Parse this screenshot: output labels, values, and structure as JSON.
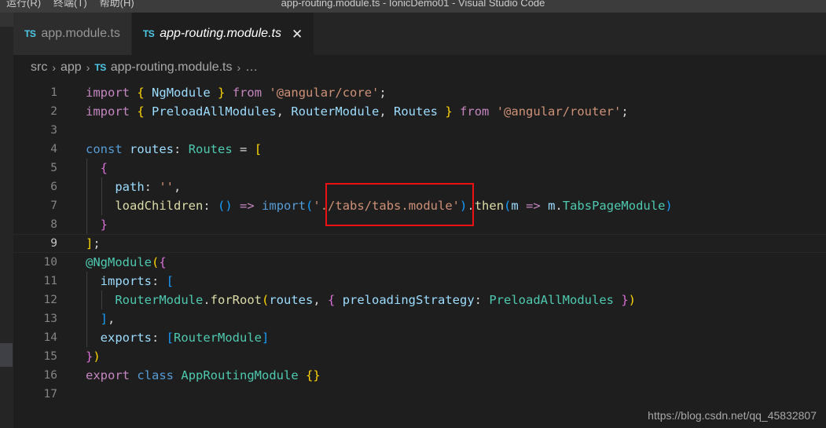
{
  "titlebar": {
    "window_title": "app-routing.module.ts - IonicDemo01 - Visual Studio Code",
    "menus": [
      {
        "label": "运行(R)"
      },
      {
        "label": "终端(T)"
      },
      {
        "label": "帮助(H)"
      }
    ]
  },
  "tabs": [
    {
      "icon": "TS",
      "label": "app.module.ts",
      "active": false
    },
    {
      "icon": "TS",
      "label": "app-routing.module.ts",
      "active": true,
      "close_label": "✕"
    }
  ],
  "breadcrumb": {
    "segments": [
      "src",
      "app",
      "app-routing.module.ts",
      "…"
    ],
    "separator": "›",
    "file_icon": "TS"
  },
  "editor": {
    "current_line": 9,
    "lines": [
      {
        "n": "1",
        "tokens": [
          {
            "t": "import",
            "c": "t-kw"
          },
          {
            "t": " ",
            "c": "t-plain"
          },
          {
            "t": "{",
            "c": "t-br1"
          },
          {
            "t": " ",
            "c": "t-plain"
          },
          {
            "t": "NgModule",
            "c": "t-var"
          },
          {
            "t": " ",
            "c": "t-plain"
          },
          {
            "t": "}",
            "c": "t-br1"
          },
          {
            "t": " ",
            "c": "t-plain"
          },
          {
            "t": "from",
            "c": "t-kw"
          },
          {
            "t": " ",
            "c": "t-plain"
          },
          {
            "t": "'@angular/core'",
            "c": "t-str"
          },
          {
            "t": ";",
            "c": "t-punc"
          }
        ]
      },
      {
        "n": "2",
        "tokens": [
          {
            "t": "import",
            "c": "t-kw"
          },
          {
            "t": " ",
            "c": "t-plain"
          },
          {
            "t": "{",
            "c": "t-br1"
          },
          {
            "t": " ",
            "c": "t-plain"
          },
          {
            "t": "PreloadAllModules",
            "c": "t-var"
          },
          {
            "t": ", ",
            "c": "t-punc"
          },
          {
            "t": "RouterModule",
            "c": "t-var"
          },
          {
            "t": ", ",
            "c": "t-punc"
          },
          {
            "t": "Routes",
            "c": "t-var"
          },
          {
            "t": " ",
            "c": "t-plain"
          },
          {
            "t": "}",
            "c": "t-br1"
          },
          {
            "t": " ",
            "c": "t-plain"
          },
          {
            "t": "from",
            "c": "t-kw"
          },
          {
            "t": " ",
            "c": "t-plain"
          },
          {
            "t": "'@angular/router'",
            "c": "t-str"
          },
          {
            "t": ";",
            "c": "t-punc"
          }
        ]
      },
      {
        "n": "3",
        "tokens": []
      },
      {
        "n": "4",
        "tokens": [
          {
            "t": "const",
            "c": "t-ctl"
          },
          {
            "t": " ",
            "c": "t-plain"
          },
          {
            "t": "routes",
            "c": "t-var"
          },
          {
            "t": ": ",
            "c": "t-punc"
          },
          {
            "t": "Routes",
            "c": "t-type"
          },
          {
            "t": " = ",
            "c": "t-punc"
          },
          {
            "t": "[",
            "c": "t-br1"
          }
        ]
      },
      {
        "n": "5",
        "guides": 1,
        "tokens": [
          {
            "t": "  {",
            "c": "t-br2"
          }
        ]
      },
      {
        "n": "6",
        "guides": 2,
        "tokens": [
          {
            "t": "    ",
            "c": "t-plain"
          },
          {
            "t": "path",
            "c": "t-var"
          },
          {
            "t": ": ",
            "c": "t-punc"
          },
          {
            "t": "''",
            "c": "t-str"
          },
          {
            "t": ",",
            "c": "t-punc"
          }
        ]
      },
      {
        "n": "7",
        "guides": 2,
        "tokens": [
          {
            "t": "    ",
            "c": "t-plain"
          },
          {
            "t": "loadChildren",
            "c": "t-fn"
          },
          {
            "t": ": ",
            "c": "t-punc"
          },
          {
            "t": "(",
            "c": "t-br3"
          },
          {
            "t": ")",
            "c": "t-br3"
          },
          {
            "t": " ",
            "c": "t-plain"
          },
          {
            "t": "=>",
            "c": "t-kw"
          },
          {
            "t": " ",
            "c": "t-plain"
          },
          {
            "t": "import",
            "c": "t-ctl"
          },
          {
            "t": "(",
            "c": "t-br3"
          },
          {
            "t": "'./tabs/tabs.module'",
            "c": "t-str"
          },
          {
            "t": ")",
            "c": "t-br3"
          },
          {
            "t": ".",
            "c": "t-punc"
          },
          {
            "t": "then",
            "c": "t-fn"
          },
          {
            "t": "(",
            "c": "t-br3"
          },
          {
            "t": "m",
            "c": "t-var"
          },
          {
            "t": " ",
            "c": "t-plain"
          },
          {
            "t": "=>",
            "c": "t-kw"
          },
          {
            "t": " ",
            "c": "t-plain"
          },
          {
            "t": "m",
            "c": "t-var"
          },
          {
            "t": ".",
            "c": "t-punc"
          },
          {
            "t": "TabsPageModule",
            "c": "t-type"
          },
          {
            "t": ")",
            "c": "t-br3"
          }
        ]
      },
      {
        "n": "8",
        "guides": 1,
        "tokens": [
          {
            "t": "  }",
            "c": "t-br2"
          }
        ]
      },
      {
        "n": "9",
        "tokens": [
          {
            "t": "]",
            "c": "t-br1"
          },
          {
            "t": ";",
            "c": "t-punc"
          }
        ]
      },
      {
        "n": "10",
        "tokens": [
          {
            "t": "@",
            "c": "t-type"
          },
          {
            "t": "NgModule",
            "c": "t-type"
          },
          {
            "t": "(",
            "c": "t-br1"
          },
          {
            "t": "{",
            "c": "t-br2"
          }
        ]
      },
      {
        "n": "11",
        "guides": 1,
        "tokens": [
          {
            "t": "  ",
            "c": "t-plain"
          },
          {
            "t": "imports",
            "c": "t-var"
          },
          {
            "t": ": ",
            "c": "t-punc"
          },
          {
            "t": "[",
            "c": "t-br3"
          }
        ]
      },
      {
        "n": "12",
        "guides": 2,
        "tokens": [
          {
            "t": "    ",
            "c": "t-plain"
          },
          {
            "t": "RouterModule",
            "c": "t-type"
          },
          {
            "t": ".",
            "c": "t-punc"
          },
          {
            "t": "forRoot",
            "c": "t-fn"
          },
          {
            "t": "(",
            "c": "t-br1"
          },
          {
            "t": "routes",
            "c": "t-var"
          },
          {
            "t": ", ",
            "c": "t-punc"
          },
          {
            "t": "{",
            "c": "t-br2"
          },
          {
            "t": " ",
            "c": "t-plain"
          },
          {
            "t": "preloadingStrategy",
            "c": "t-var"
          },
          {
            "t": ": ",
            "c": "t-punc"
          },
          {
            "t": "PreloadAllModules",
            "c": "t-type"
          },
          {
            "t": " ",
            "c": "t-plain"
          },
          {
            "t": "}",
            "c": "t-br2"
          },
          {
            "t": ")",
            "c": "t-br1"
          }
        ]
      },
      {
        "n": "13",
        "guides": 1,
        "tokens": [
          {
            "t": "  ",
            "c": "t-plain"
          },
          {
            "t": "]",
            "c": "t-br3"
          },
          {
            "t": ",",
            "c": "t-punc"
          }
        ]
      },
      {
        "n": "14",
        "guides": 1,
        "tokens": [
          {
            "t": "  ",
            "c": "t-plain"
          },
          {
            "t": "exports",
            "c": "t-var"
          },
          {
            "t": ": ",
            "c": "t-punc"
          },
          {
            "t": "[",
            "c": "t-br3"
          },
          {
            "t": "RouterModule",
            "c": "t-type"
          },
          {
            "t": "]",
            "c": "t-br3"
          }
        ]
      },
      {
        "n": "15",
        "tokens": [
          {
            "t": "}",
            "c": "t-br2"
          },
          {
            "t": ")",
            "c": "t-br1"
          }
        ]
      },
      {
        "n": "16",
        "tokens": [
          {
            "t": "export",
            "c": "t-kw"
          },
          {
            "t": " ",
            "c": "t-plain"
          },
          {
            "t": "class",
            "c": "t-ctl"
          },
          {
            "t": " ",
            "c": "t-plain"
          },
          {
            "t": "AppRoutingModule",
            "c": "t-type"
          },
          {
            "t": " ",
            "c": "t-plain"
          },
          {
            "t": "{}",
            "c": "t-br1"
          }
        ]
      },
      {
        "n": "17",
        "tokens": []
      }
    ]
  },
  "annotation": {
    "label": "red-highlight-box",
    "color": "#ee1111",
    "targets_text": "'./tabs/tabs.module"
  },
  "watermark": {
    "text": "https://blog.csdn.net/qq_45832807"
  },
  "colors": {
    "editor_bg": "#1e1e1e",
    "tabbar_bg": "#252526",
    "inactive_tab_bg": "#2d2d2d",
    "titlebar_bg": "#3c3c3c",
    "accent_ts": "#4ec9e8"
  }
}
